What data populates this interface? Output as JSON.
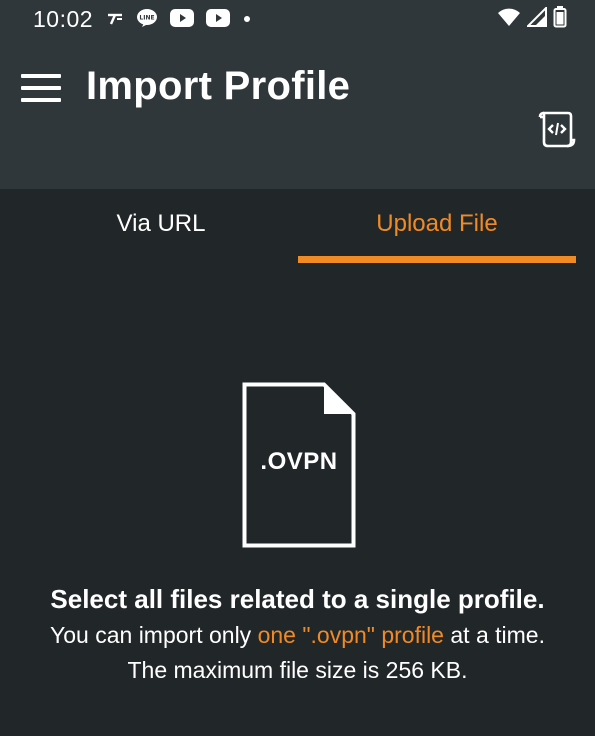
{
  "status_bar": {
    "time": "10:02",
    "left_icons": [
      "tethering-icon",
      "line-icon",
      "youtube-icon",
      "youtube-icon",
      "dot-icon"
    ],
    "right_icons": [
      "wifi-icon",
      "cell-signal-icon",
      "battery-icon"
    ]
  },
  "app_bar": {
    "title": "Import Profile",
    "menu_icon": "hamburger-icon",
    "action_icon": "script-file-icon"
  },
  "tabs": [
    {
      "label": "Via URL",
      "selected": false
    },
    {
      "label": "Upload File",
      "selected": true
    }
  ],
  "upload": {
    "file_label": ".OVPN",
    "title": "Select all files related to a single profile.",
    "line1_prefix": "You can import only ",
    "line1_highlight": "one \".ovpn\" profile",
    "line1_suffix": " at a time.",
    "line2": "The maximum file size is 256 KB."
  },
  "colors": {
    "background": "#212629",
    "app_bar": "#30373a",
    "accent": "#f08a24",
    "text": "#ffffff"
  }
}
